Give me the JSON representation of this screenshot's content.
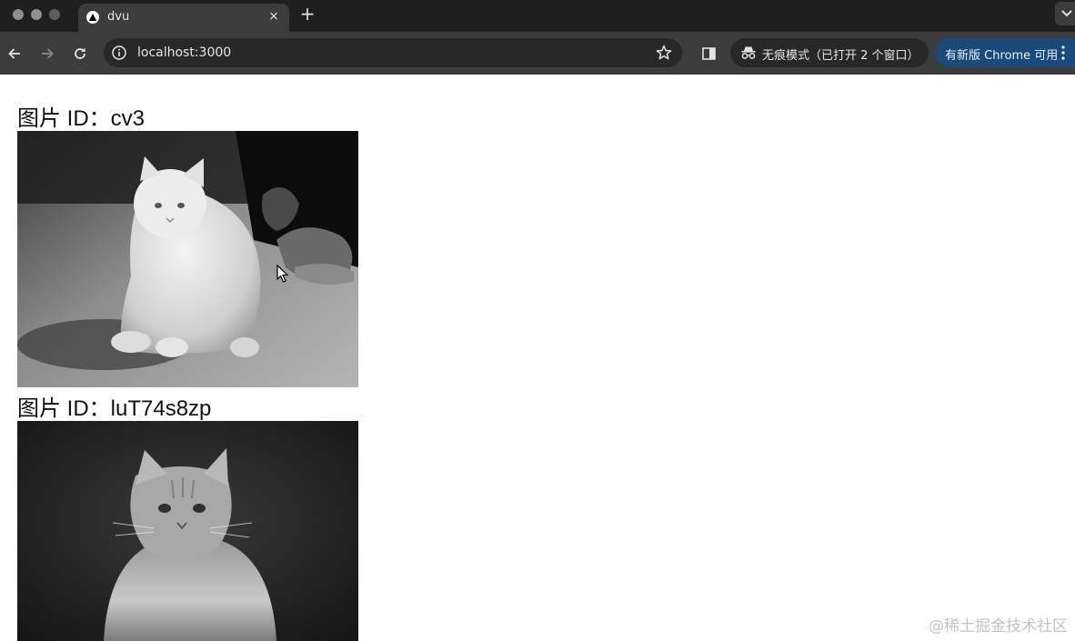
{
  "browser": {
    "tab": {
      "title": "dvu",
      "close": "×"
    },
    "new_tab": "+",
    "address": {
      "url": "localhost:3000"
    },
    "incognito": {
      "label": "无痕模式（已打开 2 个窗口）"
    },
    "update": {
      "label": "有新版 Chrome 可用"
    }
  },
  "page": {
    "images": [
      {
        "caption": "图片 ID：cv3"
      },
      {
        "caption": "图片 ID：luT74s8zp"
      }
    ]
  },
  "watermark": "@稀土掘金技术社区",
  "colors": {
    "tabbar_bg": "#1f1f1f",
    "toolbar_bg": "#3c3c3c",
    "omnibox_bg": "#282828",
    "update_bg": "#1b4a78"
  }
}
